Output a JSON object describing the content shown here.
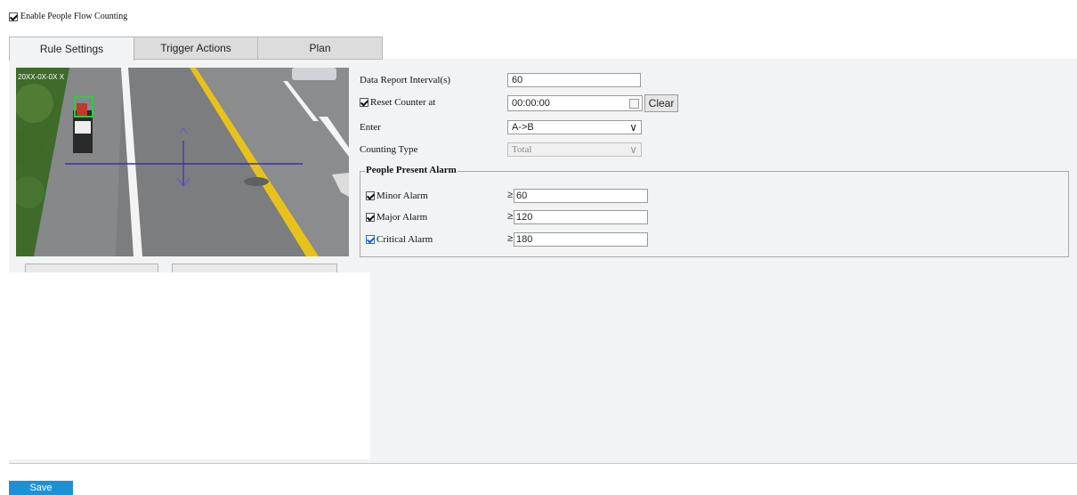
{
  "enable": {
    "label": "Enable People Flow Counting",
    "checked": true
  },
  "tabs": [
    {
      "label": "Rule Settings",
      "active": true
    },
    {
      "label": "Trigger Actions",
      "active": false
    },
    {
      "label": "Plan",
      "active": false
    }
  ],
  "video": {
    "overlay_text": "20XX-0X-0X X"
  },
  "form": {
    "data_report_interval": {
      "label": "Data Report Interval(s)",
      "value": "60"
    },
    "reset_counter": {
      "label": "Reset Counter at",
      "checked": true,
      "value": "00:00:00",
      "clear_label": "Clear"
    },
    "enter": {
      "label": "Enter",
      "value": "A->B"
    },
    "counting_type": {
      "label": "Counting Type",
      "value": "Total"
    }
  },
  "alarm_group": {
    "title": "People Present Alarm",
    "minor": {
      "label": "Minor Alarm",
      "checked": true,
      "symbol": "≥",
      "value": "60"
    },
    "major": {
      "label": "Major Alarm",
      "checked": true,
      "symbol": "≥",
      "value": "120"
    },
    "critical": {
      "label": "Critical Alarm",
      "checked": true,
      "symbol": "≥",
      "value": "180"
    }
  },
  "save_label": "Save",
  "colors": {
    "panel_bg": "#f2f3f5",
    "save_bg": "#1e90d6",
    "line": "#3a2fb0",
    "lane_yellow": "#e8c21a"
  }
}
